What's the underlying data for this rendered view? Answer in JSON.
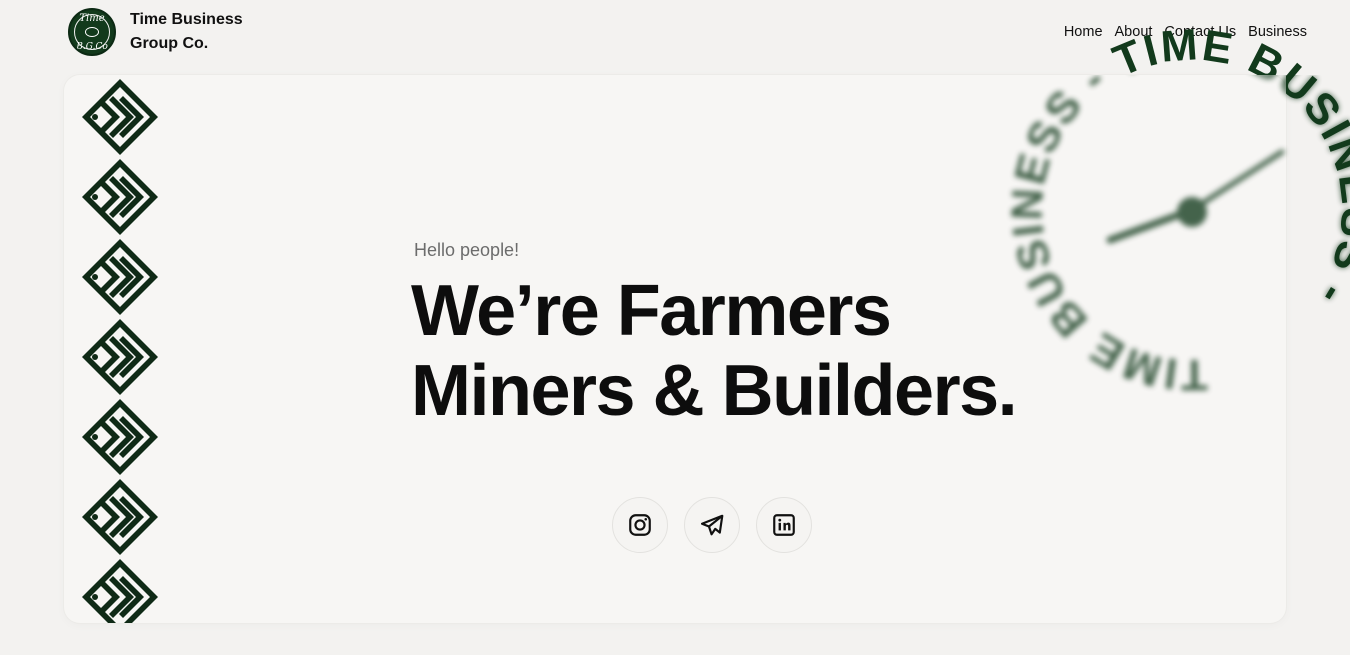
{
  "brand": {
    "name_line1": "Time Business",
    "name_line2": "Group Co.",
    "logo_top": "Time",
    "logo_bottom": "B.G.Co",
    "color": "#123a1c"
  },
  "nav": {
    "items": [
      "Home",
      "About",
      "Contact Us",
      "Business"
    ]
  },
  "hero": {
    "greeting": "Hello people!",
    "headline_line1": "We’re Farmers",
    "headline_line2": "Miners & Builders."
  },
  "socials": [
    {
      "icon": "instagram-icon"
    },
    {
      "icon": "telegram-icon"
    },
    {
      "icon": "linkedin-icon"
    }
  ],
  "circular_text": "TIME BUSINESS - TIME BUSINESS - ",
  "colors": {
    "accent": "#123a1c",
    "background": "#f3f2f0",
    "card": "#f7f6f4"
  }
}
